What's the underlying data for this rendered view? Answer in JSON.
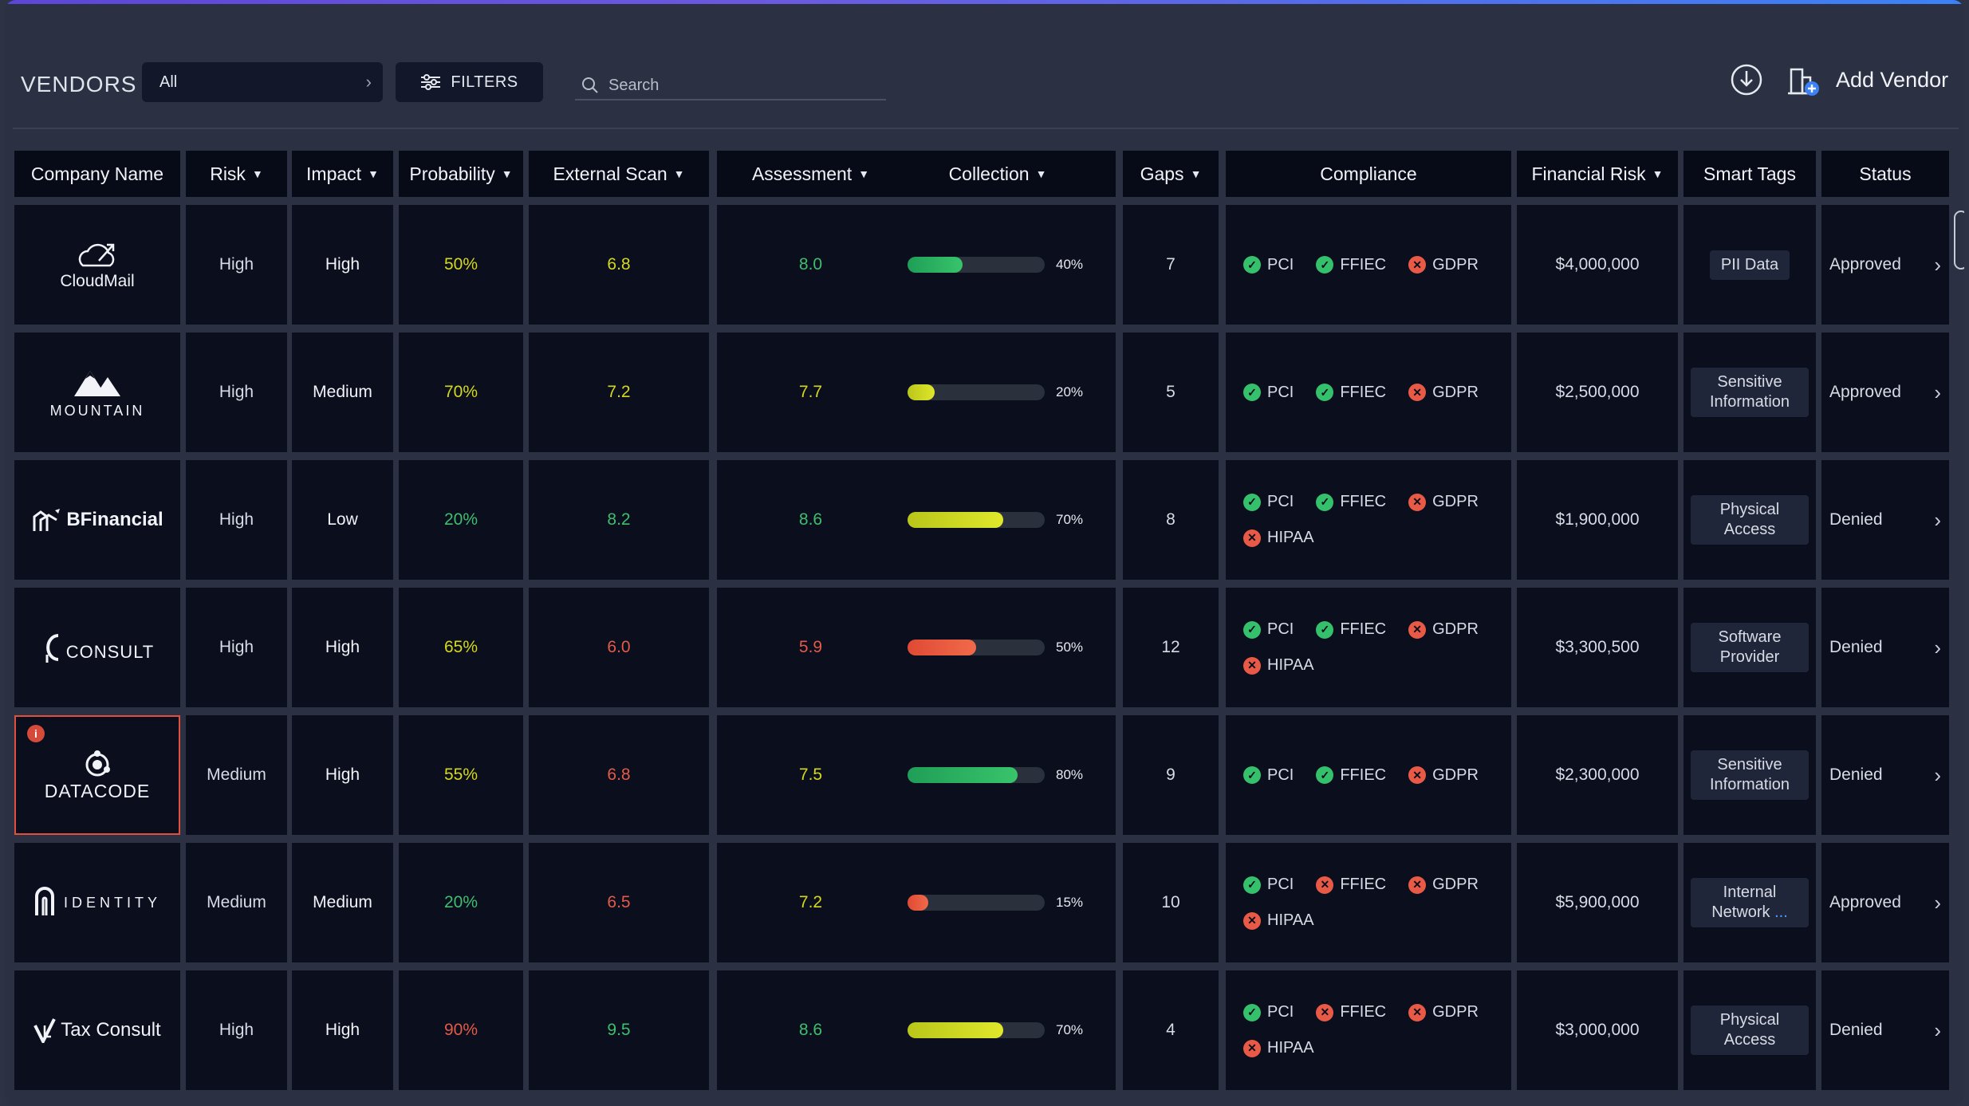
{
  "toolbar": {
    "title": "VENDORS",
    "filter_select": "All",
    "filters_label": "FILTERS",
    "search_placeholder": "Search",
    "add_vendor_label": "Add Vendor"
  },
  "columns": [
    "Company Name",
    "Risk",
    "Impact",
    "Probability",
    "External Scan",
    "Assessment",
    "Collection",
    "Gaps",
    "Compliance",
    "Financial Risk",
    "Smart Tags",
    "Status"
  ],
  "rows": [
    {
      "company": "CloudMail",
      "risk": "High",
      "impact": "High",
      "probability": "50%",
      "prob_color": "yellow",
      "external_scan": "6.8",
      "scan_color": "yellow",
      "assessment": "8.0",
      "assess_color": "green",
      "collection": 0.4,
      "collection_label": "40%",
      "collection_color": "green",
      "gaps": "7",
      "compliance": [
        {
          "name": "PCI",
          "ok": true
        },
        {
          "name": "FFIEC",
          "ok": true
        },
        {
          "name": "GDPR",
          "ok": false
        }
      ],
      "financial_risk": "$4,000,000",
      "tag": "PII Data",
      "tag_more": "",
      "status": "Approved"
    },
    {
      "company": "MOUNTAIN",
      "risk": "High",
      "impact": "Medium",
      "probability": "70%",
      "prob_color": "yellow",
      "external_scan": "7.2",
      "scan_color": "yellow",
      "assessment": "7.7",
      "assess_color": "yellow",
      "collection": 0.2,
      "collection_label": "20%",
      "collection_color": "yellow",
      "gaps": "5",
      "compliance": [
        {
          "name": "PCI",
          "ok": true
        },
        {
          "name": "FFIEC",
          "ok": true
        },
        {
          "name": "GDPR",
          "ok": false
        }
      ],
      "financial_risk": "$2,500,000",
      "tag": "Sensitive Information",
      "tag_more": "",
      "status": "Approved"
    },
    {
      "company": "BFinancial",
      "risk": "High",
      "impact": "Low",
      "probability": "20%",
      "prob_color": "green",
      "external_scan": "8.2",
      "scan_color": "green",
      "assessment": "8.6",
      "assess_color": "green",
      "collection": 0.7,
      "collection_label": "70%",
      "collection_color": "yellow",
      "gaps": "8",
      "compliance": [
        {
          "name": "PCI",
          "ok": true
        },
        {
          "name": "FFIEC",
          "ok": true
        },
        {
          "name": "GDPR",
          "ok": false
        },
        {
          "name": "HIPAA",
          "ok": false
        }
      ],
      "financial_risk": "$1,900,000",
      "tag": "Physical Access",
      "tag_more": "",
      "status": "Denied"
    },
    {
      "company": "CONSULT",
      "risk": "High",
      "impact": "High",
      "probability": "65%",
      "prob_color": "yellow",
      "external_scan": "6.0",
      "scan_color": "red",
      "assessment": "5.9",
      "assess_color": "red",
      "collection": 0.5,
      "collection_label": "50%",
      "collection_color": "red",
      "gaps": "12",
      "compliance": [
        {
          "name": "PCI",
          "ok": true
        },
        {
          "name": "FFIEC",
          "ok": true
        },
        {
          "name": "GDPR",
          "ok": false
        },
        {
          "name": "HIPAA",
          "ok": false
        }
      ],
      "financial_risk": "$3,300,500",
      "tag": "Software Provider",
      "tag_more": "",
      "status": "Denied"
    },
    {
      "company": "DATACODE",
      "risk": "Medium",
      "impact": "High",
      "probability": "55%",
      "prob_color": "yellow",
      "external_scan": "6.8",
      "scan_color": "red",
      "assessment": "7.5",
      "assess_color": "yellow",
      "collection": 0.8,
      "collection_label": "80%",
      "collection_color": "green",
      "gaps": "9",
      "compliance": [
        {
          "name": "PCI",
          "ok": true
        },
        {
          "name": "FFIEC",
          "ok": true
        },
        {
          "name": "GDPR",
          "ok": false
        }
      ],
      "financial_risk": "$2,300,000",
      "tag": "Sensitive Information",
      "tag_more": "",
      "status": "Denied"
    },
    {
      "company": "IDENTITY",
      "risk": "Medium",
      "impact": "Medium",
      "probability": "20%",
      "prob_color": "green",
      "external_scan": "6.5",
      "scan_color": "red",
      "assessment": "7.2",
      "assess_color": "yellow",
      "collection": 0.15,
      "collection_label": "15%",
      "collection_color": "red",
      "gaps": "10",
      "compliance": [
        {
          "name": "PCI",
          "ok": true
        },
        {
          "name": "FFIEC",
          "ok": false
        },
        {
          "name": "GDPR",
          "ok": false
        },
        {
          "name": "HIPAA",
          "ok": false
        }
      ],
      "financial_risk": "$5,900,000",
      "tag": "Internal Network",
      "tag_more": "...",
      "status": "Approved"
    },
    {
      "company": "Tax Consult",
      "risk": "High",
      "impact": "High",
      "probability": "90%",
      "prob_color": "red",
      "external_scan": "9.5",
      "scan_color": "green",
      "assessment": "8.6",
      "assess_color": "green",
      "collection": 0.7,
      "collection_label": "70%",
      "collection_color": "yellow",
      "gaps": "4",
      "compliance": [
        {
          "name": "PCI",
          "ok": true
        },
        {
          "name": "FFIEC",
          "ok": false
        },
        {
          "name": "GDPR",
          "ok": false
        },
        {
          "name": "HIPAA",
          "ok": false
        }
      ],
      "financial_risk": "$3,000,000",
      "tag": "Physical Access",
      "tag_more": "",
      "status": "Denied"
    }
  ],
  "colors": {
    "accent": "#5b46d6",
    "ok": "#35c06b",
    "fail": "#e85a46",
    "yellow": "#d4d91c",
    "green": "#3fbf6e",
    "red": "#e45a49"
  }
}
